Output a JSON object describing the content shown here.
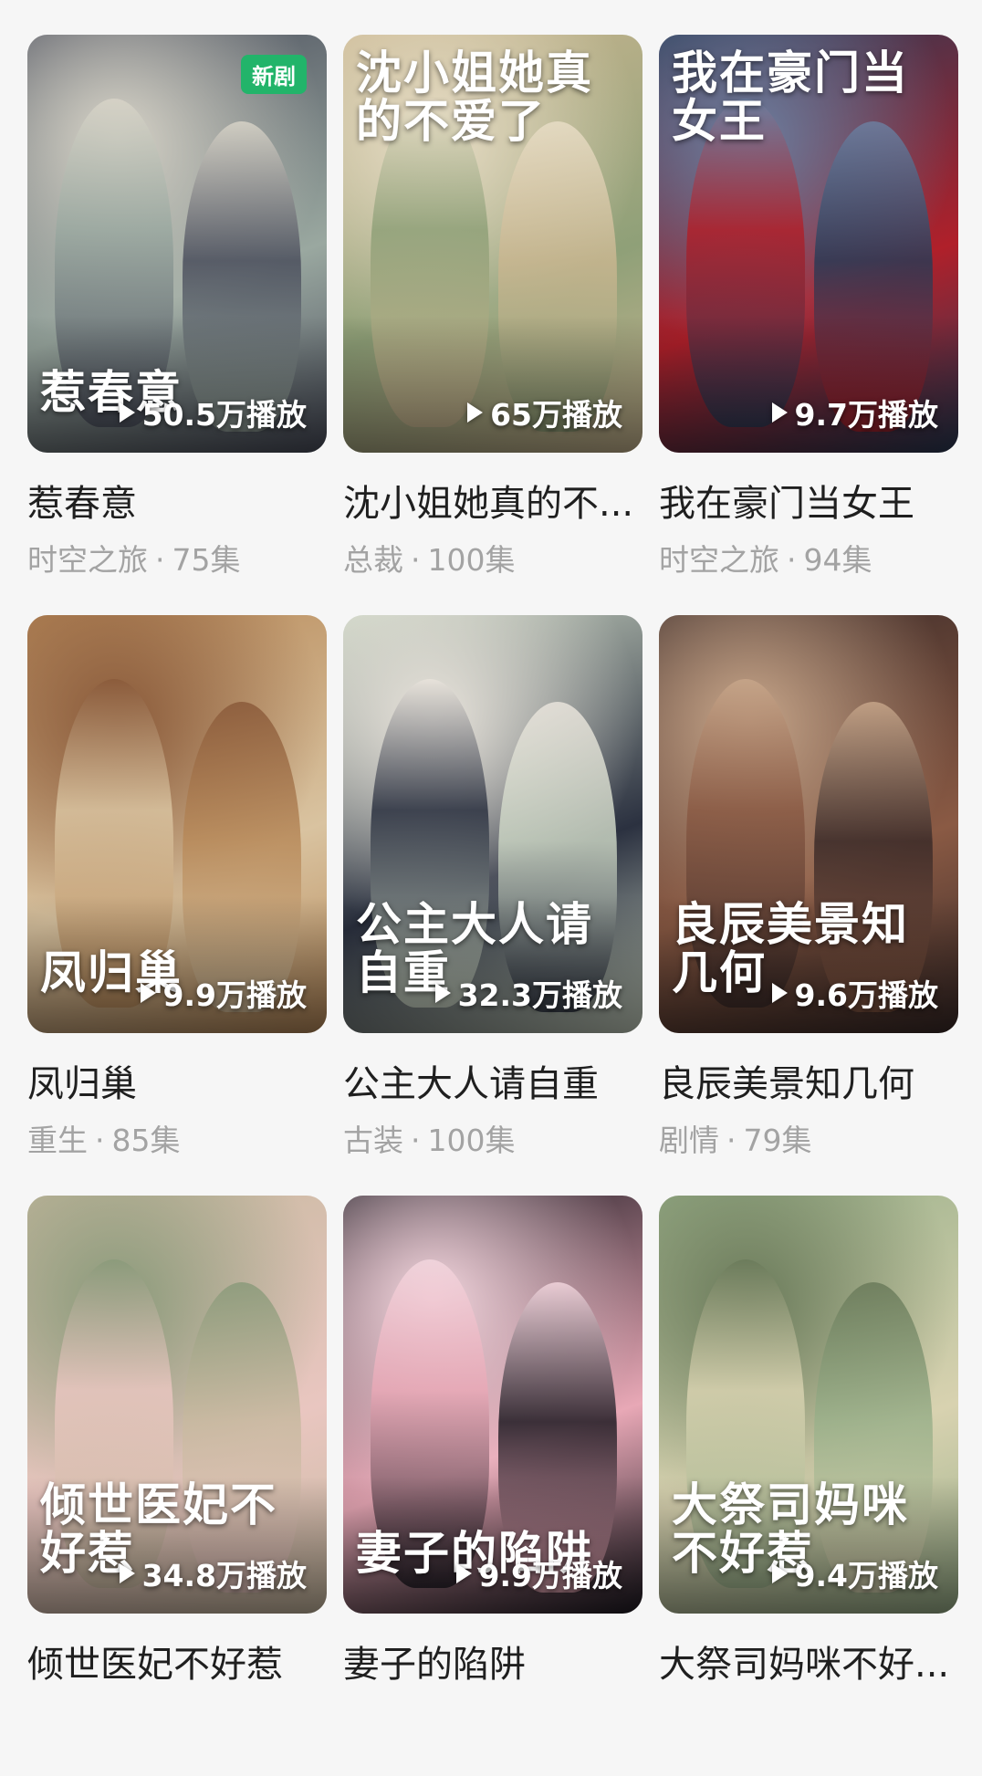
{
  "dramas": [
    {
      "id": "rechunyi",
      "title": "惹春意",
      "poster_text": "惹春意",
      "badge": "新剧",
      "plays": "50.5万播放",
      "genre": "时空之旅",
      "dot": "·",
      "episodes": "75集",
      "colors": [
        "#4a4e5c",
        "#9aa8a0",
        "#d8d4c8"
      ]
    },
    {
      "id": "shenxiaojie",
      "title": "沈小姐她真的不...",
      "poster_text": "沈小姐她真的不爱了",
      "badge": "",
      "plays": "65万播放",
      "genre": "总裁",
      "dot": "·",
      "episodes": "100集",
      "colors": [
        "#c9b690",
        "#8fa078",
        "#e8ddc6"
      ]
    },
    {
      "id": "haomennvwang",
      "title": "我在豪门当女王",
      "poster_text": "我在豪门当女王",
      "badge": "",
      "plays": "9.7万播放",
      "genre": "时空之旅",
      "dot": "·",
      "episodes": "94集",
      "colors": [
        "#2a3a55",
        "#b0202a",
        "#6d7fa0"
      ]
    },
    {
      "id": "fengguichao",
      "title": "凤归巢",
      "poster_text": "凤归巢",
      "badge": "",
      "plays": "9.9万播放",
      "genre": "重生",
      "dot": "·",
      "episodes": "85集",
      "colors": [
        "#b88a5a",
        "#d9c3a0",
        "#8a5a3a"
      ]
    },
    {
      "id": "gongzhudaren",
      "title": "公主大人请自重",
      "poster_text": "公主大人请自重",
      "badge": "",
      "plays": "32.3万播放",
      "genre": "古装",
      "dot": "·",
      "episodes": "100集",
      "colors": [
        "#c9d3c2",
        "#2b3140",
        "#e9e4dc"
      ]
    },
    {
      "id": "liangchen",
      "title": "良辰美景知几何",
      "poster_text": "良辰美景知几何",
      "badge": "",
      "plays": "9.6万播放",
      "genre": "剧情",
      "dot": "·",
      "episodes": "79集",
      "colors": [
        "#3a2a28",
        "#8a5a44",
        "#c7a68a"
      ]
    },
    {
      "id": "qingshiyifei",
      "title": "倾世医妃不好惹",
      "poster_text": "倾世医妃不好惹",
      "badge": "",
      "plays": "34.8万播放",
      "genre": "",
      "dot": "",
      "episodes": "",
      "colors": [
        "#c8b9a0",
        "#e9c6c0",
        "#8a9a7a"
      ]
    },
    {
      "id": "qizidexianjing",
      "title": "妻子的陷阱",
      "poster_text": "妻子的陷阱",
      "badge": "",
      "plays": "9.9万播放",
      "genre": "",
      "dot": "",
      "episodes": "",
      "colors": [
        "#1e1a22",
        "#e8a8b6",
        "#f3d6de"
      ]
    },
    {
      "id": "dajisi",
      "title": "大祭司妈咪不好...",
      "poster_text": "大祭司妈咪不好惹",
      "badge": "",
      "plays": "9.4万播放",
      "genre": "",
      "dot": "",
      "episodes": "",
      "colors": [
        "#9ab08a",
        "#d8d2b0",
        "#6a7a5a"
      ]
    }
  ]
}
